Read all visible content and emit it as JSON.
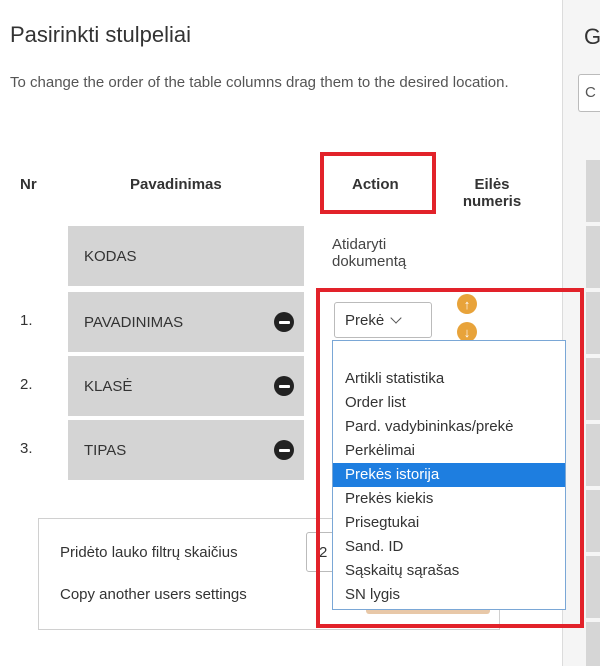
{
  "panel": {
    "title": "Pasirinkti stulpeliai",
    "description": "To change the order of the table columns drag them to the desired location."
  },
  "table": {
    "headers": {
      "nr": "Nr",
      "name": "Pavadinimas",
      "action": "Action",
      "order": "Eilės numeris"
    },
    "rows": [
      {
        "nr": "",
        "name": "KODAS",
        "action": "Atidaryti dokumentą"
      },
      {
        "nr": "1.",
        "name": "PAVADINIMAS"
      },
      {
        "nr": "2.",
        "name": "KLASĖ"
      },
      {
        "nr": "3.",
        "name": "TIPAS"
      }
    ]
  },
  "action_select": {
    "value": "Prekė",
    "options": [
      "Artikli statistika",
      "Order list",
      "Pard. vadybininkas/prekė",
      "Perkėlimai",
      "Prekės istorija",
      "Prekės kiekis",
      "Prisegtukai",
      "Sand. ID",
      "Sąskaitų sąrašas",
      "SN lygis"
    ],
    "highlighted_index": 4
  },
  "filters": {
    "count_label": "Pridėto lauko filtrų skaičius",
    "count_value": "2",
    "copy_label": "Copy another users settings"
  },
  "right_panel": {
    "title_fragment": "G",
    "field_fragment": "C"
  },
  "colors": {
    "highlight_red": "#e2222a",
    "selected_option": "#1e7ee0",
    "row_bg": "#d4d4d4",
    "arrow_orange": "#e8a33a"
  }
}
